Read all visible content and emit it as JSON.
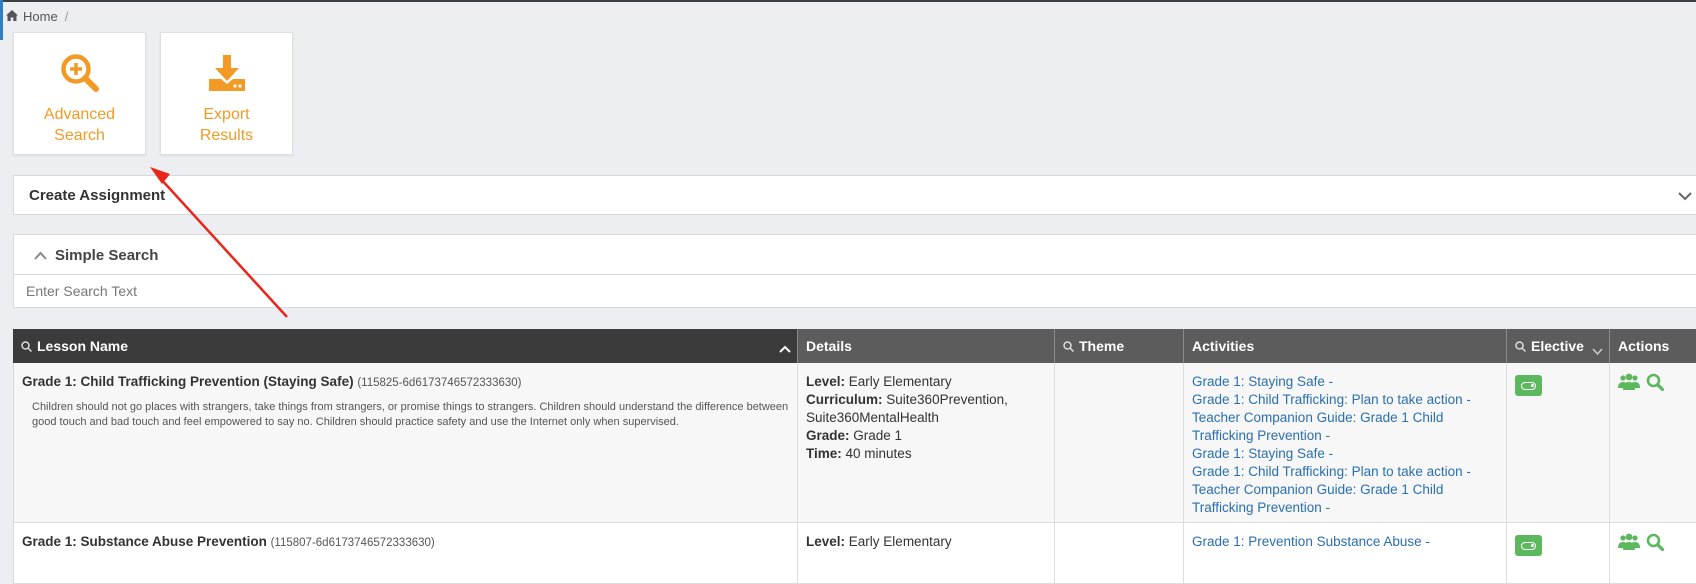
{
  "breadcrumb": {
    "home": "Home",
    "separator": "/"
  },
  "tiles": {
    "advanced_search": "Advanced Search",
    "export_results": "Export Results"
  },
  "create_assignment": {
    "title": "Create Assignment"
  },
  "simple_search": {
    "title": "Simple Search",
    "placeholder": "Enter Search Text"
  },
  "table": {
    "headers": {
      "lesson_name": "Lesson Name",
      "details": "Details",
      "theme": "Theme",
      "activities": "Activities",
      "elective": "Elective",
      "actions": "Actions"
    },
    "labels": {
      "level": "Level:",
      "curriculum": "Curriculum:",
      "grade": "Grade:",
      "time": "Time:"
    },
    "rows": [
      {
        "name": "Grade 1: Child Trafficking Prevention (Staying Safe)",
        "id": "(115825-6d6173746572333630)",
        "description": "Children should not go places with strangers, take things from strangers, or promise things to strangers. Children should understand the difference between good touch and bad touch and feel empowered to say no. Children should practice safety and use the Internet only when supervised.",
        "level": "Early Elementary",
        "curriculum_1": "Suite360Prevention,",
        "curriculum_2": "Suite360MentalHealth",
        "grade": "Grade 1",
        "time": "40 minutes",
        "activities": [
          "Grade 1: Staying Safe -",
          "Grade 1: Child Trafficking: Plan to take action -",
          "Teacher Companion Guide: Grade 1 Child Trafficking Prevention -",
          "Grade 1: Staying Safe -",
          "Grade 1: Child Trafficking: Plan to take action -",
          "Teacher Companion Guide: Grade 1 Child Trafficking Prevention -"
        ]
      },
      {
        "name": "Grade 1: Substance Abuse Prevention",
        "id": "(115807-6d6173746572333630)",
        "level": "Early Elementary",
        "activities": [
          "Grade 1: Prevention Substance Abuse -"
        ]
      }
    ]
  },
  "colors": {
    "accent": "#f29a25",
    "link": "#2a6fb0",
    "success": "#5cb85c",
    "header_dark": "#3b3b3b",
    "header_mid": "#5c5c5c",
    "annotation": "#e8261c"
  }
}
